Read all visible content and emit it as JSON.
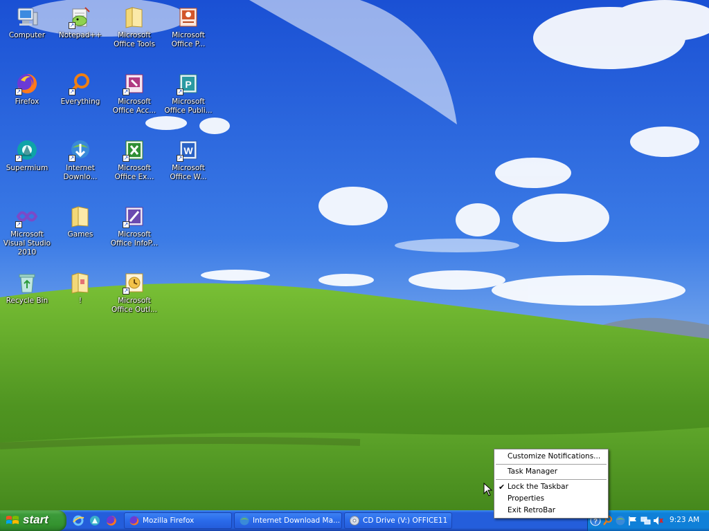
{
  "desktop": {
    "icons": [
      {
        "label": "Computer"
      },
      {
        "label": "Notepad++"
      },
      {
        "label": "Microsoft Office Tools"
      },
      {
        "label": "Microsoft Office P..."
      },
      {
        "label": "Firefox"
      },
      {
        "label": "Everything"
      },
      {
        "label": "Microsoft Office Acc..."
      },
      {
        "label": "Microsoft Office Publi..."
      },
      {
        "label": "Supermium"
      },
      {
        "label": "Internet Downlo..."
      },
      {
        "label": "Microsoft Office Ex..."
      },
      {
        "label": "Microsoft Office W..."
      },
      {
        "label": "Microsoft Visual Studio 2010"
      },
      {
        "label": "Games"
      },
      {
        "label": "Microsoft Office InfoP..."
      },
      {
        "label": "Recycle Bin"
      },
      {
        "label": "!"
      },
      {
        "label": "Microsoft Office Outl..."
      }
    ]
  },
  "context_menu": {
    "items": [
      {
        "label": "Customize Notifications..."
      },
      {
        "label": "Task Manager"
      },
      {
        "label": "Lock the Taskbar",
        "checked": true
      },
      {
        "label": "Properties"
      },
      {
        "label": "Exit RetroBar"
      }
    ]
  },
  "taskbar": {
    "start_label": "start",
    "tasks": [
      {
        "label": "Mozilla Firefox"
      },
      {
        "label": "Internet Download Ma..."
      },
      {
        "label": "CD Drive (V:) OFFICE11"
      }
    ],
    "clock": "9:23 AM"
  },
  "colors": {
    "taskbar_blue": "#245edb",
    "start_green": "#3c9a3a",
    "tray_blue": "#0f80d8",
    "sky_blue": "#3a6fd8",
    "hill_green": "#5a9e28"
  }
}
